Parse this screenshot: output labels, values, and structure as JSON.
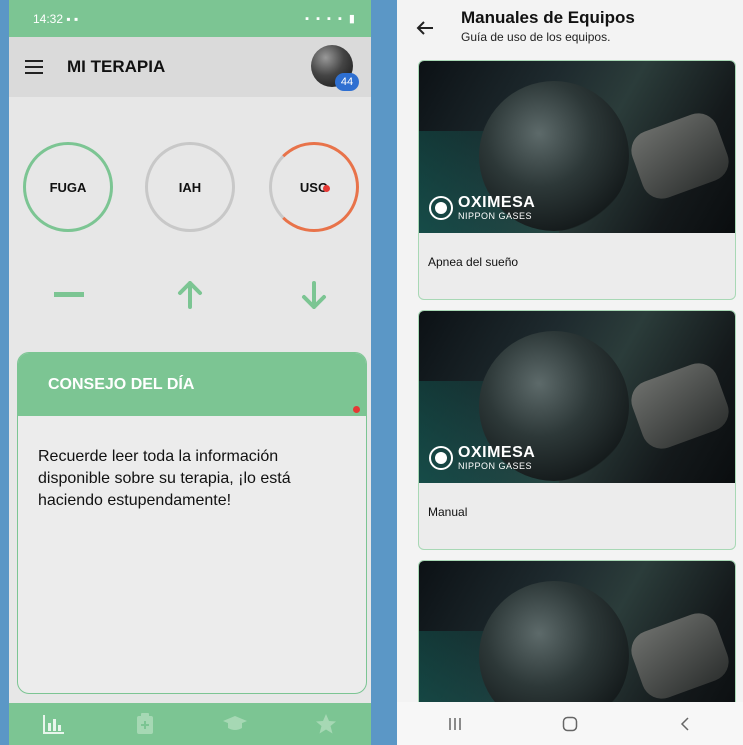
{
  "left": {
    "status": {
      "time": "14:32",
      "icons_left": "▪ ▪",
      "icons_right": "▪ ▪ ▪ ▪ ▮"
    },
    "app_title": "MI TERAPIA",
    "avatar_badge": "44",
    "gauges": [
      {
        "label": "FUGA",
        "trend": "dash",
        "color": "#7cc593"
      },
      {
        "label": "IAH",
        "trend": "up",
        "color": "#c8c8c8"
      },
      {
        "label": "USO",
        "trend": "down",
        "color": "#e8734a"
      }
    ],
    "tip": {
      "title": "CONSEJO DEL DÍA",
      "text": "Recuerde leer toda la información disponible sobre su terapia, ¡lo está haciendo estupendamente!"
    },
    "bottom_nav": [
      "chart-icon",
      "clipboard-icon",
      "graduation-cap-icon",
      "star-icon"
    ]
  },
  "right": {
    "title": "Manuales de Equipos",
    "subtitle": "Guía de uso de los equipos.",
    "logo": {
      "brand": "OXIMESA",
      "sub": "NIPPON GASES"
    },
    "cards": [
      {
        "label": "Apnea del sueño"
      },
      {
        "label": "Manual"
      },
      {
        "label": ""
      }
    ],
    "sys_nav": [
      "recent-apps-icon",
      "home-icon",
      "back-icon"
    ]
  },
  "colors": {
    "accent": "#7cc593",
    "warning": "#e8734a",
    "badge": "#2e6fd1",
    "alert_dot": "#e53935"
  }
}
